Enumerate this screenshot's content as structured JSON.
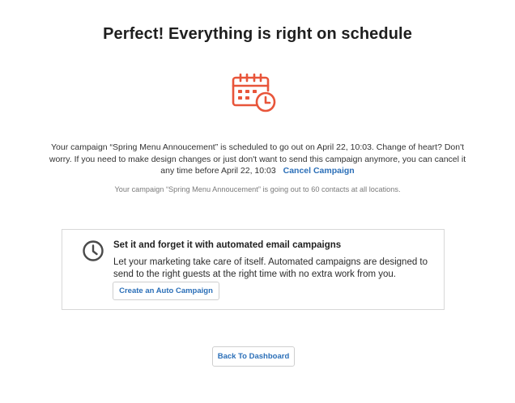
{
  "header": {
    "title": "Perfect! Everything is right on schedule"
  },
  "schedule": {
    "message": "Your campaign “Spring Menu Annoucement” is scheduled to go out on April 22, 10:03. Change of heart? Don't worry. If you need to make design changes or just don't want to send this campaign anymore, you can cancel it any time before April 22, 10:03",
    "cancel_label": "Cancel Campaign",
    "audience_note": "Your campaign “Spring Menu Annoucement” is going out to 60 contacts at all locations."
  },
  "auto_card": {
    "title": "Set it and forget it with automated email campaigns",
    "body": "Let your marketing take care of itself. Automated campaigns are designed to send to the right guests at the right time with no extra work from you.",
    "button_label": "Create an Auto Campaign"
  },
  "footer": {
    "dashboard_label": "Back To Dashboard"
  },
  "colors": {
    "accent": "#e8553a",
    "link": "#2b6fb8"
  },
  "icons": {
    "schedule_icon": "calendar-clock-icon",
    "card_icon": "clock-icon"
  }
}
